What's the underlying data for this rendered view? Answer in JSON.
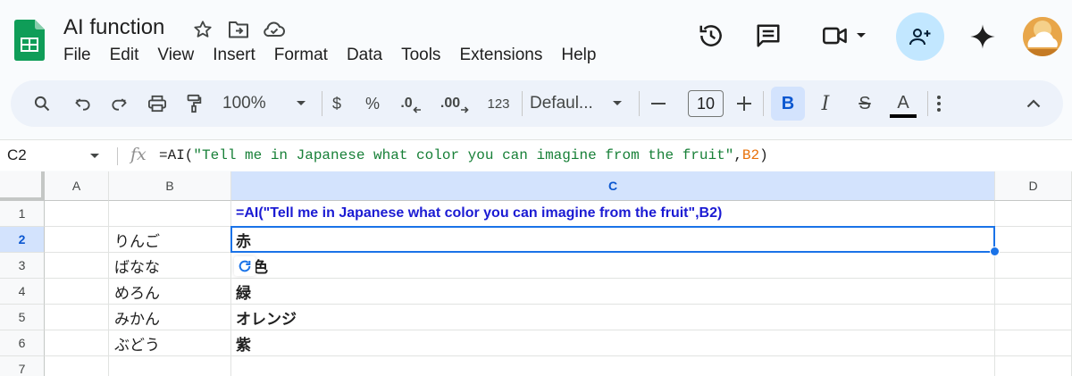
{
  "app": {
    "title": "AI function",
    "menu": [
      "File",
      "Edit",
      "View",
      "Insert",
      "Format",
      "Data",
      "Tools",
      "Extensions",
      "Help"
    ]
  },
  "toolbar": {
    "zoom": "100%",
    "currency": "$",
    "percent": "%",
    "dec_decrease": ".0",
    "dec_increase": ".00",
    "number_format": "123",
    "font_family": "Defaul...",
    "font_size": "10",
    "bold": "B",
    "italic": "I",
    "strike": "S",
    "text_color": "A"
  },
  "formula_bar": {
    "cell_ref": "C2",
    "fx": "fx",
    "formula_prefix": "=AI(",
    "formula_string": "\"Tell me in Japanese what color you can imagine from the fruit\"",
    "formula_comma": ",",
    "formula_ref": "B2",
    "formula_suffix": ")"
  },
  "sheet": {
    "columns": [
      "A",
      "B",
      "C",
      "D"
    ],
    "rows": [
      "1",
      "2",
      "3",
      "4",
      "5",
      "6",
      "7"
    ],
    "active_cell": "C2",
    "c1_formula": "=AI(\"Tell me in Japanese what color you can imagine from the fruit\",B2)",
    "b": [
      "",
      "りんご",
      "ばなな",
      "めろん",
      "みかん",
      "ぶどう",
      ""
    ],
    "c": [
      "",
      "赤",
      "色",
      "緑",
      "オレンジ",
      "紫",
      ""
    ]
  },
  "colors": {
    "accent": "#1a73e8",
    "header_active": "#d3e3fd",
    "formula_string": "#188038",
    "formula_ref": "#e8710a",
    "c1_text": "#1b1bd3"
  }
}
